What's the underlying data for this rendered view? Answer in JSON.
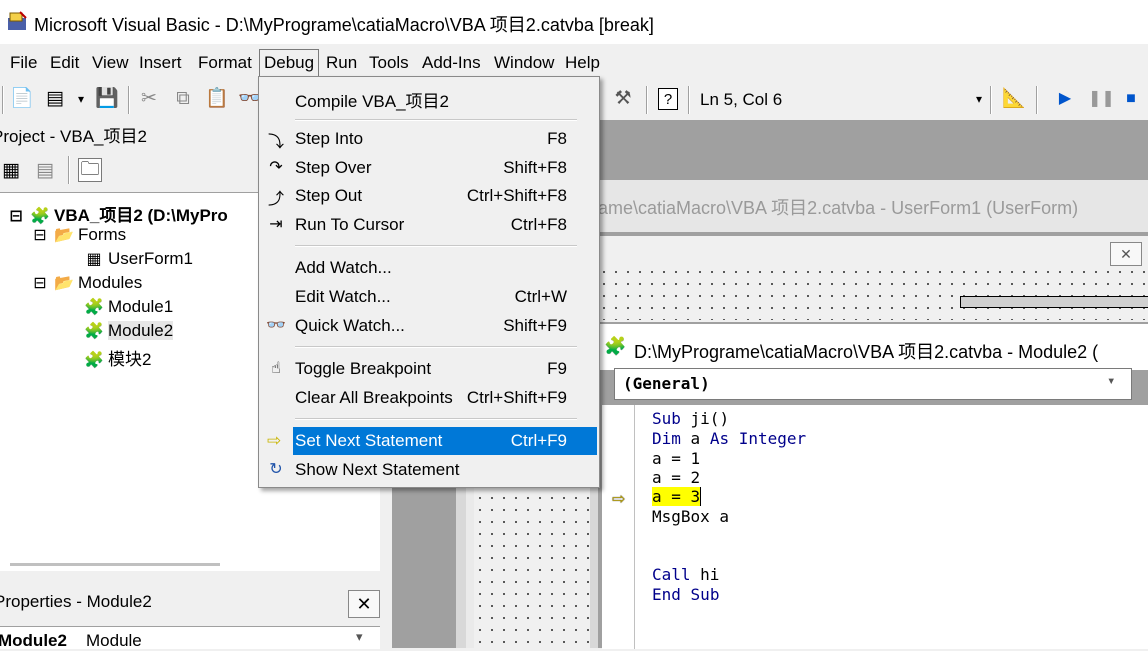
{
  "window": {
    "title": "Microsoft Visual Basic - D:\\MyPrograme\\catiaMacro\\VBA 项目2.catvba [break]"
  },
  "menubar": [
    "File",
    "Edit",
    "View",
    "Insert",
    "Format",
    "Debug",
    "Run",
    "Tools",
    "Add-Ins",
    "Window",
    "Help"
  ],
  "toolbar": {
    "position": "Ln 5, Col 6"
  },
  "debug_menu": {
    "compile": "Compile VBA_项目2",
    "step_into": {
      "label": "Step Into",
      "shortcut": "F8"
    },
    "step_over": {
      "label": "Step Over",
      "shortcut": "Shift+F8"
    },
    "step_out": {
      "label": "Step Out",
      "shortcut": "Ctrl+Shift+F8"
    },
    "run_to_cursor": {
      "label": "Run To Cursor",
      "shortcut": "Ctrl+F8"
    },
    "add_watch": {
      "label": "Add Watch..."
    },
    "edit_watch": {
      "label": "Edit Watch...",
      "shortcut": "Ctrl+W"
    },
    "quick_watch": {
      "label": "Quick Watch...",
      "shortcut": "Shift+F9"
    },
    "toggle_breakpoint": {
      "label": "Toggle Breakpoint",
      "shortcut": "F9"
    },
    "clear_breakpoints": {
      "label": "Clear All Breakpoints",
      "shortcut": "Ctrl+Shift+F9"
    },
    "set_next": {
      "label": "Set Next Statement",
      "shortcut": "Ctrl+F9"
    },
    "show_next": {
      "label": "Show Next Statement"
    }
  },
  "project_panel": {
    "caption": "Project - VBA_项目2",
    "root": "VBA_项目2 (D:\\MyPro",
    "forms": "Forms",
    "userform1": "UserForm1",
    "modules": "Modules",
    "module1": "Module1",
    "module2": "Module2",
    "module_cn": "模块2"
  },
  "properties_panel": {
    "caption": "Properties - Module2",
    "object_name": "Module2",
    "object_type": "Module"
  },
  "userform_window": {
    "title": "ame\\catiaMacro\\VBA 项目2.catvba - UserForm1 (UserForm)"
  },
  "module_window": {
    "title": "D:\\MyPrograme\\catiaMacro\\VBA 项目2.catvba - Module2 (",
    "object_combo": "(General)",
    "code": {
      "l1_kw": "Sub",
      "l1_rest": " ji()",
      "l2_kw1": "Dim",
      "l2_mid": " a ",
      "l2_kw2": "As",
      "l2_kw3": "Integer",
      "l3": "a = 1",
      "l4": "a = 2",
      "l5": "a = 3",
      "l6": "MsgBox a",
      "l9_kw": "Call",
      "l9_rest": " hi",
      "l10_kw1": "End",
      "l10_kw2": "Sub"
    }
  }
}
